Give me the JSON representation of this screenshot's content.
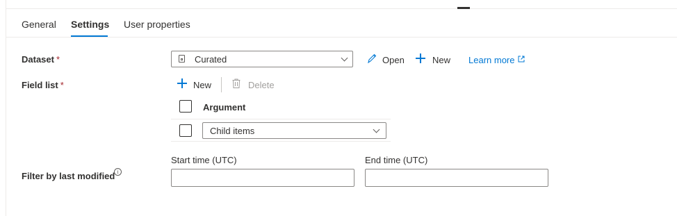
{
  "tabs": [
    {
      "label": "General",
      "active": false
    },
    {
      "label": "Settings",
      "active": true
    },
    {
      "label": "User properties",
      "active": false
    }
  ],
  "dataset": {
    "label": "Dataset",
    "required_mark": "*",
    "selected_value": "Curated",
    "file_icon": "dataset-file-icon",
    "open_label": "Open",
    "new_label": "New",
    "learn_more_label": "Learn more"
  },
  "field_list": {
    "label": "Field list",
    "required_mark": "*",
    "new_label": "New",
    "delete_label": "Delete",
    "column_header": "Argument",
    "rows": [
      {
        "selected_value": "Child items",
        "checked": false
      }
    ]
  },
  "filter": {
    "label": "Filter by last modified",
    "info_glyph": "i",
    "start_label": "Start time (UTC)",
    "start_value": "",
    "end_label": "End time (UTC)",
    "end_value": ""
  },
  "colors": {
    "accent": "#0078d4",
    "required": "#a4262c",
    "text": "#323130",
    "disabled": "#a19f9d",
    "border": "#8a8886"
  }
}
